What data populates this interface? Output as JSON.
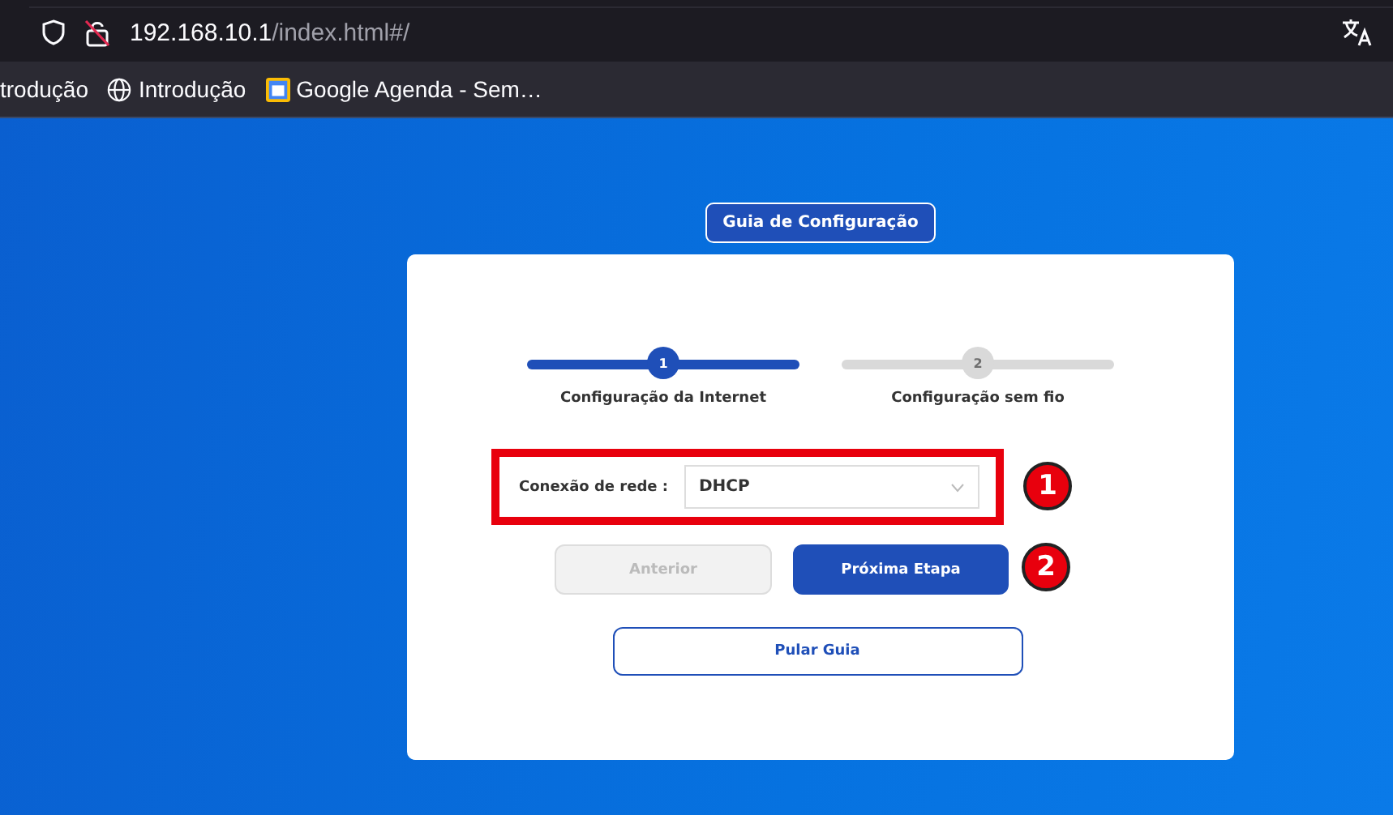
{
  "browser": {
    "url_host": "192.168.10.1",
    "url_path": "/index.html#/",
    "bookmarks": [
      {
        "label": "trodução",
        "kind": "plain"
      },
      {
        "label": "Introdução",
        "kind": "globe"
      },
      {
        "label": "Google Agenda - Sem…",
        "kind": "calendar"
      }
    ]
  },
  "guide": {
    "title": "Guia de Configuração",
    "steps": [
      {
        "number": "1",
        "label": "Configuração da Internet",
        "selected": true
      },
      {
        "number": "2",
        "label": "Configuração sem fio",
        "selected": false
      }
    ],
    "connection": {
      "label": "Conexão de rede :",
      "value": "DHCP"
    },
    "buttons": [
      {
        "label": "Anterior",
        "kind": "secondary",
        "disabled": true
      },
      {
        "label": "Próxima Etapa",
        "kind": "primary",
        "disabled": false
      }
    ],
    "skip": "Pular Guia"
  },
  "annotations": [
    "1",
    "2"
  ]
}
